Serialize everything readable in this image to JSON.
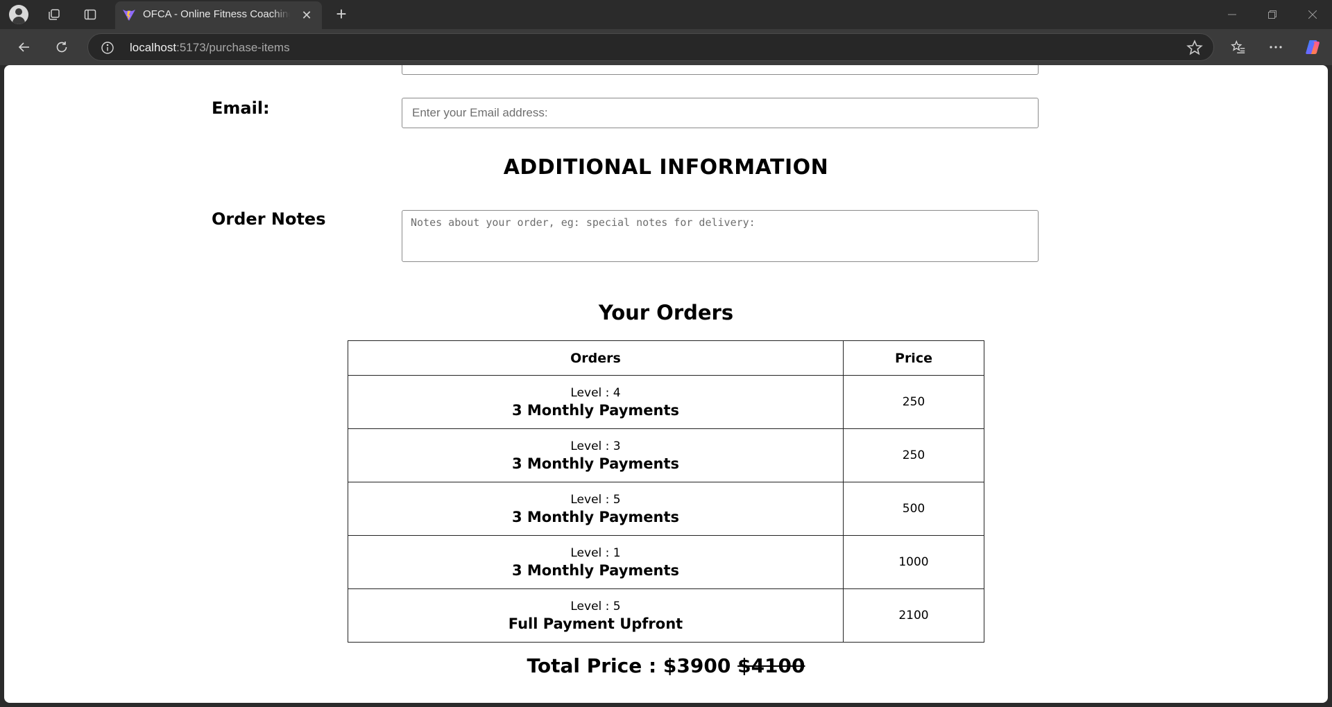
{
  "browser": {
    "tab_title": "OFCA - Online Fitness Coaching App",
    "url_host": "localhost",
    "url_rest": ":5173/purchase-items",
    "colors": {
      "chrome_bg": "#2b2b2b",
      "toolbar_bg": "#3b3b3b",
      "page_bg": "#ffffff"
    }
  },
  "form": {
    "email_label": "Email:",
    "email_placeholder": "Enter your Email address:",
    "additional_heading": "ADDITIONAL INFORMATION",
    "notes_label": "Order Notes",
    "notes_placeholder": "Notes about your order, eg: special notes for delivery:"
  },
  "orders": {
    "heading": "Your Orders",
    "columns": [
      "Orders",
      "Price"
    ],
    "rows": [
      {
        "level": "Level : 4",
        "plan": "3 Monthly Payments",
        "price": "250"
      },
      {
        "level": "Level : 3",
        "plan": "3 Monthly Payments",
        "price": "250"
      },
      {
        "level": "Level : 5",
        "plan": "3 Monthly Payments",
        "price": "500"
      },
      {
        "level": "Level : 1",
        "plan": "3 Monthly Payments",
        "price": "1000"
      },
      {
        "level": "Level : 5",
        "plan": "Full Payment Upfront",
        "price": "2100"
      }
    ]
  },
  "total": {
    "label": "Total Price :",
    "price": "$3900",
    "original_price": "$4100"
  }
}
